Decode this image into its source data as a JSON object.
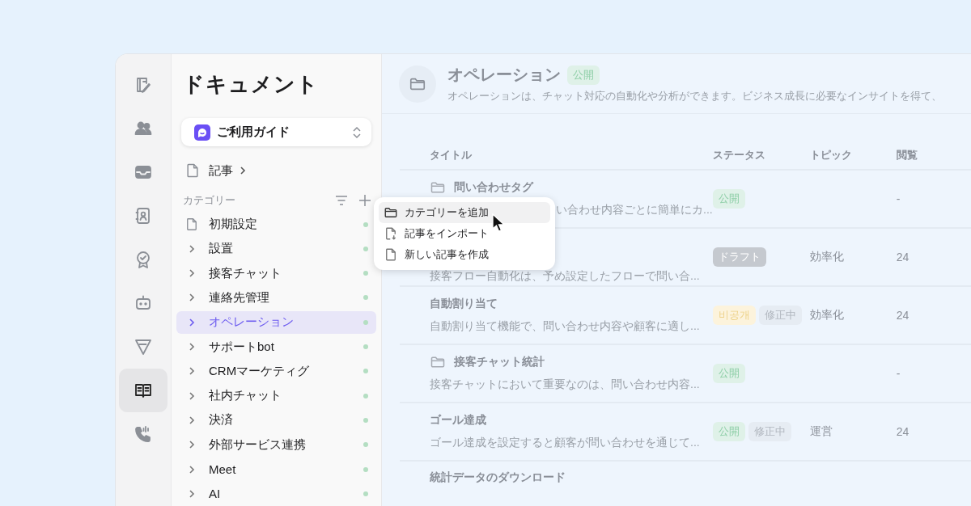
{
  "rail": {
    "items": [
      {
        "selected": false
      },
      {
        "selected": false
      },
      {
        "selected": false
      },
      {
        "selected": false
      },
      {
        "selected": false
      },
      {
        "selected": false
      },
      {
        "selected": false
      },
      {
        "selected": true
      },
      {
        "selected": false
      }
    ]
  },
  "sidebar": {
    "title": "ドキュメント",
    "guide": {
      "label": "ご利用ガイド"
    },
    "articles_link": {
      "label": "記事"
    },
    "category_header": "カテゴリー",
    "categories": [
      {
        "kind": "page",
        "label": "初期設定",
        "selected": false
      },
      {
        "kind": "folder",
        "label": "設置",
        "selected": false
      },
      {
        "kind": "folder",
        "label": "接客チャット",
        "selected": false
      },
      {
        "kind": "folder",
        "label": "連絡先管理",
        "selected": false
      },
      {
        "kind": "folder",
        "label": "オペレーション",
        "selected": true
      },
      {
        "kind": "folder",
        "label": "サポートbot",
        "selected": false
      },
      {
        "kind": "folder",
        "label": "CRMマーケティグ",
        "selected": false
      },
      {
        "kind": "folder",
        "label": "社内チャット",
        "selected": false
      },
      {
        "kind": "folder",
        "label": "決済",
        "selected": false
      },
      {
        "kind": "folder",
        "label": "外部サービス連携",
        "selected": false
      },
      {
        "kind": "folder",
        "label": "Meet",
        "selected": false
      },
      {
        "kind": "folder",
        "label": "AI",
        "selected": false
      }
    ]
  },
  "menu": {
    "items": [
      {
        "label": "カテゴリーを追加",
        "highlighted": true
      },
      {
        "label": "記事をインポート",
        "highlighted": false
      },
      {
        "label": "新しい記事を作成",
        "highlighted": false
      }
    ]
  },
  "page": {
    "title": "オペレーション",
    "badge": "公開",
    "description": "オペレーションは、チャット対応の自動化や分析ができます。ビジネス成長に必要なインサイトを得て、"
  },
  "table": {
    "columns": [
      "タイトル",
      "ステータス",
      "トピック",
      "閲覧"
    ],
    "rows": [
      {
        "kind": "folder",
        "title": "問い合わせタグ",
        "description": "い合わせ内容ごとに簡単にカ...",
        "desc_hidden_start": true,
        "tags": [
          {
            "label": "公開",
            "kind": "published"
          }
        ],
        "topic": "",
        "views": "-"
      },
      {
        "kind": "article",
        "description": "接客フロー自動化は、予め設定したフローで問い合...",
        "tags": [
          {
            "label": "ドラフト",
            "kind": "draft"
          }
        ],
        "topic": "効率化",
        "views": "24"
      },
      {
        "kind": "article",
        "title": "自動割り当て",
        "description": "自動割り当て機能で、問い合わせ内容や顧客に適し...",
        "tags": [
          {
            "label": "비공개",
            "kind": "private"
          },
          {
            "label": "修正中",
            "kind": "editing"
          }
        ],
        "topic": "効率化",
        "views": "24"
      },
      {
        "kind": "folder",
        "title": "接客チャット統計",
        "description": "接客チャットにおいて重要なのは、問い合わせ内容...",
        "tags": [
          {
            "label": "公開",
            "kind": "published"
          }
        ],
        "topic": "",
        "views": "-"
      },
      {
        "kind": "article",
        "title": "ゴール達成",
        "description": "ゴール達成を設定すると顧客が問い合わせを通じて...",
        "tags": [
          {
            "label": "公開",
            "kind": "published"
          },
          {
            "label": "修正中",
            "kind": "editing"
          }
        ],
        "topic": "運営",
        "views": "24"
      },
      {
        "kind": "article",
        "title": "統計データのダウンロード",
        "tags": [],
        "topic": "",
        "views": ""
      }
    ]
  }
}
